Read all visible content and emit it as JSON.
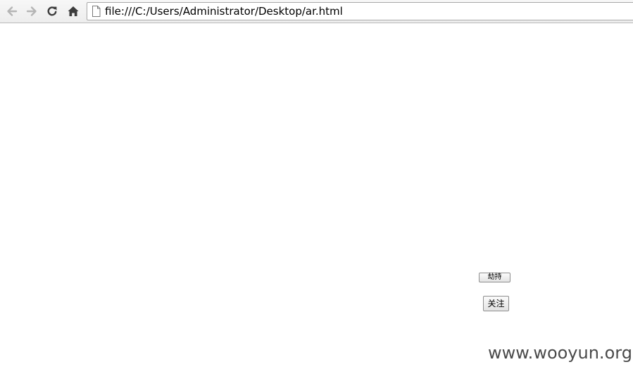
{
  "browser": {
    "icons": {
      "back": "back-arrow-icon",
      "forward": "forward-arrow-icon",
      "reload": "reload-icon",
      "home": "home-icon",
      "page": "page-icon"
    },
    "url": "file:///C:/Users/Administrator/Desktop/ar.html"
  },
  "page": {
    "hijack_button_label": "劫持",
    "follow_button_label": "关注"
  },
  "watermark": {
    "text": "www.wooyun.org"
  }
}
